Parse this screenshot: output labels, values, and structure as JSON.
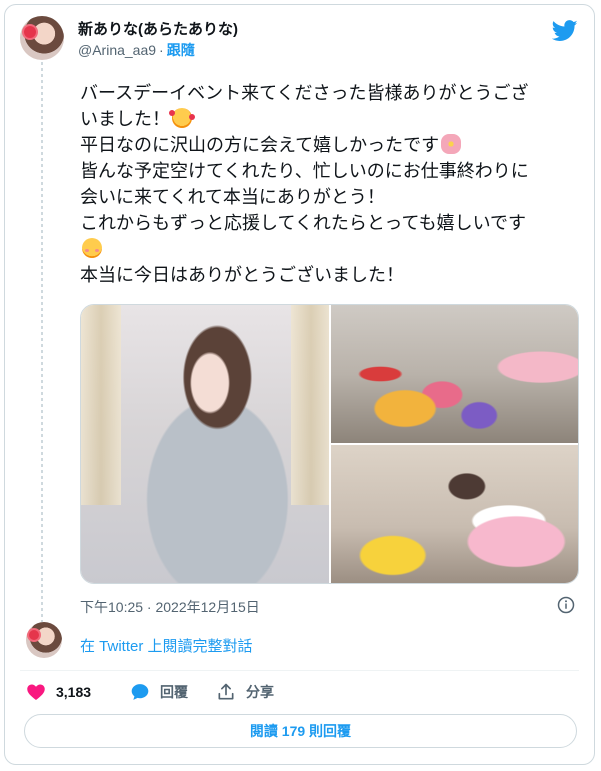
{
  "author": {
    "display_name": "新ありな(あらたありな)",
    "handle": "@Arina_aa9",
    "separator": "·",
    "follow_label": "跟隨"
  },
  "tweet": {
    "lines": [
      {
        "text": "バースデーイベント来てくださった皆様ありがとうござ",
        "emoji": null
      },
      {
        "text": "いました！",
        "emoji": "smiling-face-with-hearts"
      },
      {
        "text": "平日なのに沢山の方に会えて嬉しかったです",
        "emoji": "cherry-blossom"
      },
      {
        "text": "皆んな予定空けてくれたり、忙しいのにお仕事終わりに",
        "emoji": null
      },
      {
        "text": "会いに来てくれて本当にありがとう！",
        "emoji": null
      },
      {
        "text": "これからもずっと応援してくれたらとっても嬉しいです",
        "emoji": null
      },
      {
        "text": "",
        "emoji": "smiling-face-with-blush"
      },
      {
        "text": "本当に今日はありがとうございました！",
        "emoji": null
      }
    ]
  },
  "media": {
    "photos": [
      {
        "subject": "woman-in-gray-gown-portrait"
      },
      {
        "subject": "birthday-gifts-pile"
      },
      {
        "subject": "woman-with-flower-cake"
      }
    ]
  },
  "timestamp": "下午10:25 · 2022年12月15日",
  "read_conversation": "在 Twitter 上閱讀完整對話",
  "actions": {
    "likes": "3,183",
    "reply_label": "回覆",
    "share_label": "分享"
  },
  "read_replies_button": "閱讀 179 則回覆",
  "colors": {
    "accent": "#1d9bf0",
    "like": "#f91880",
    "text": "#0f1419",
    "muted": "#536471",
    "border": "#cfd9de"
  },
  "icons": [
    "twitter-bird-icon",
    "info-icon",
    "heart-icon",
    "reply-bubble-icon",
    "share-icon"
  ]
}
